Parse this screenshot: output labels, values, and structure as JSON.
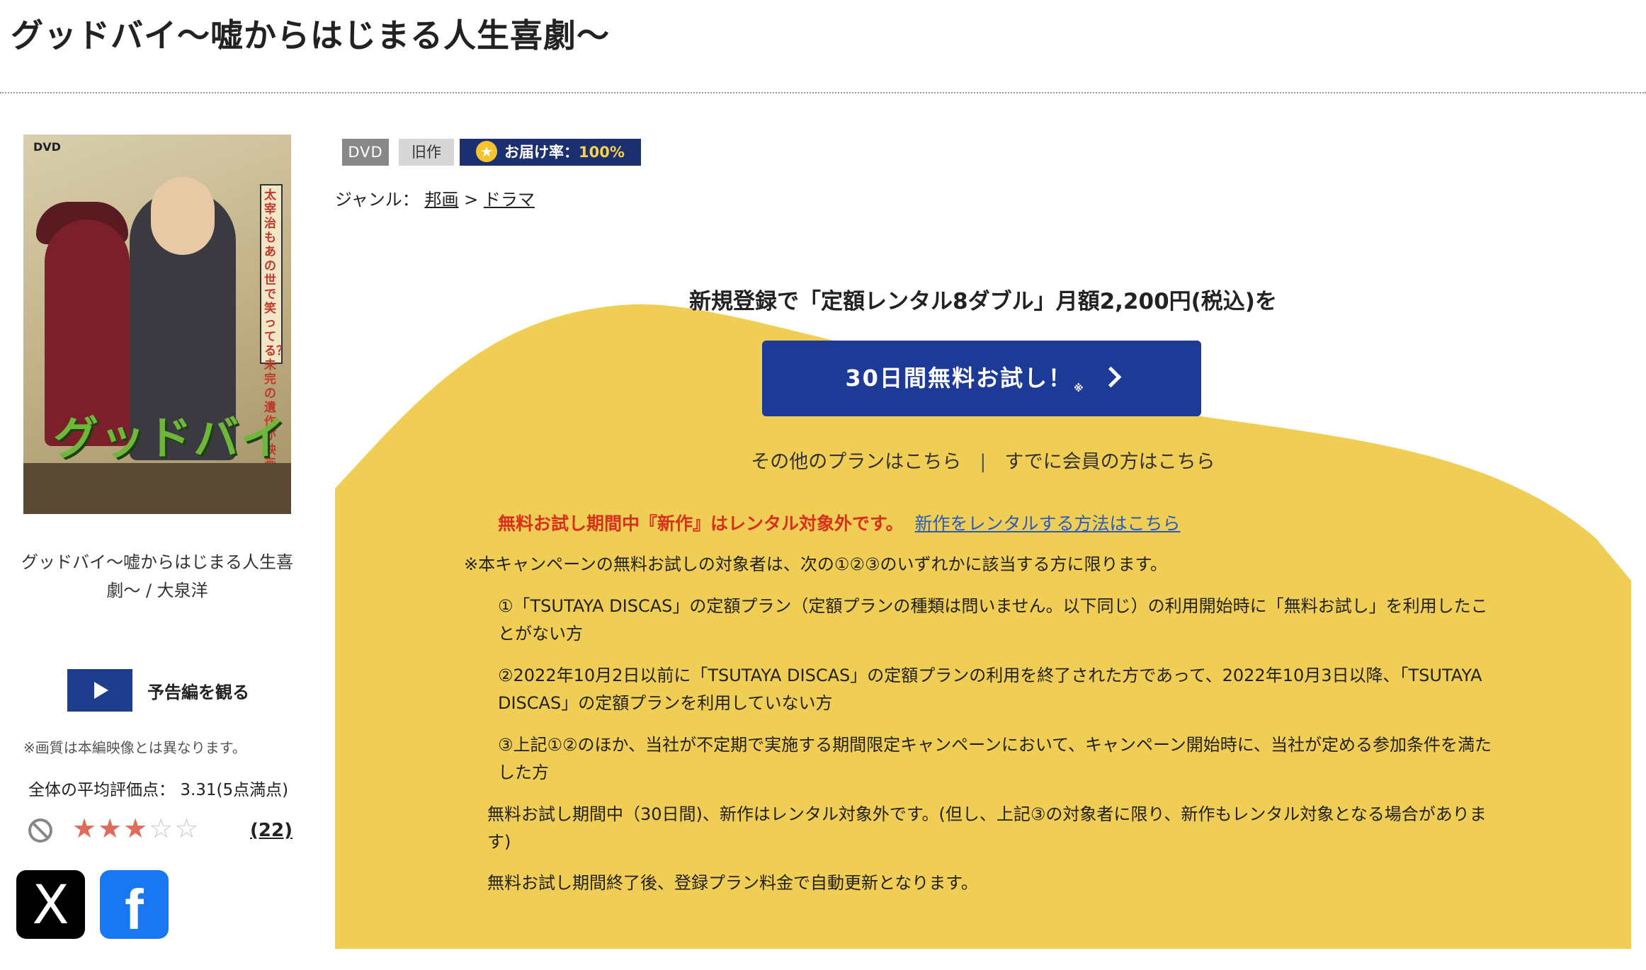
{
  "page": {
    "title": "グッドバイ〜嘘からはじまる人生喜劇〜"
  },
  "product": {
    "cover_dvd_mark": "DVD",
    "cover_logo": "グッドバイ",
    "cover_vertical_text": "太宰治もあの世で笑ってる？未完の遺作が映画化！",
    "caption": "グッドバイ〜嘘からはじまる人生喜劇〜 / 大泉洋",
    "trailer_label": "予告編を観る",
    "image_note": "※画質は本編映像とは異なります。",
    "average_rating_label": "全体の平均評価点：",
    "average_rating_value": "3.31(5点満点)",
    "rating_value": 3.31,
    "review_count": "(22)"
  },
  "badges": {
    "format": "DVD",
    "release_type": "旧作",
    "delivery_rate_label": "お届け率：",
    "delivery_rate_value": "100%"
  },
  "genre": {
    "label": "ジャンル：",
    "items": [
      "邦画",
      "ドラマ"
    ],
    "separator": ">"
  },
  "promo": {
    "headline": "新規登録で「定額レンタル8ダブル」月額2,200円(税込)を",
    "cta_label": "30日間無料お試し！",
    "cta_mark": "※",
    "other_plans_link": "その他のプランはこちら",
    "link_separator": "|",
    "member_link": "すでに会員の方はこちら",
    "warning_text": "無料お試し期間中『新作』はレンタル対象外です。",
    "warning_link": "新作をレンタルする方法はこちら",
    "eligibility_intro": "※本キャンペーンの無料お試しの対象者は、次の①②③のいずれかに該当する方に限ります。",
    "condition_1": "①「TSUTAYA DISCAS」の定額プラン（定額プランの種類は問いません。以下同じ）の利用開始時に「無料お試し」を利用したことがない方",
    "condition_2": "②2022年10月2日以前に「TSUTAYA DISCAS」の定額プランの利用を終了された方であって、2022年10月3日以降、「TSUTAYA DISCAS」の定額プランを利用していない方",
    "condition_3": "③上記①②のほか、当社が不定期で実施する期間限定キャンペーンにおいて、キャンペーン開始時に、当社が定める参加条件を満たした方",
    "note_1": "無料お試し期間中（30日間)、新作はレンタル対象外です。(但し、上記③の対象者に限り、新作もレンタル対象となる場合があります)",
    "note_2": "無料お試し期間終了後、登録プラン料金で自動更新となります。"
  },
  "social": {
    "x_label": "X",
    "facebook_label": "f"
  },
  "colors": {
    "promo_yellow": "#f0cd55",
    "cta_blue": "#1c3a96",
    "warning_red": "#d9301d",
    "star_color": "#e06b5a"
  }
}
